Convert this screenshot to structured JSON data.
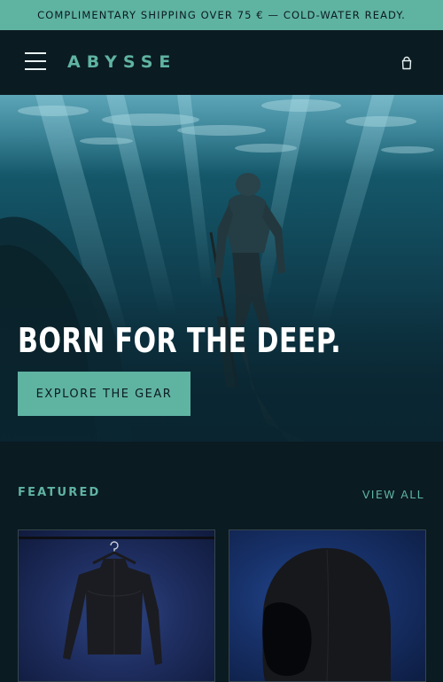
{
  "announcement": {
    "text": "COMPLIMENTARY SHIPPING OVER 75 € — COLD-WATER READY."
  },
  "header": {
    "logo": "ABYSSE",
    "menu_icon": "hamburger-menu-icon",
    "cart_icon": "shopping-bag-icon"
  },
  "hero": {
    "title": "BORN FOR THE DEEP.",
    "cta_label": "EXPLORE THE GEAR"
  },
  "featured": {
    "label": "FEATURED",
    "view_all": "VIEW ALL",
    "products": [
      {
        "image": "wetsuit-image"
      },
      {
        "image": "hood-image"
      }
    ]
  },
  "colors": {
    "accent": "#5fb3a1",
    "background": "#0b1b22",
    "text": "#e8f2f2"
  }
}
